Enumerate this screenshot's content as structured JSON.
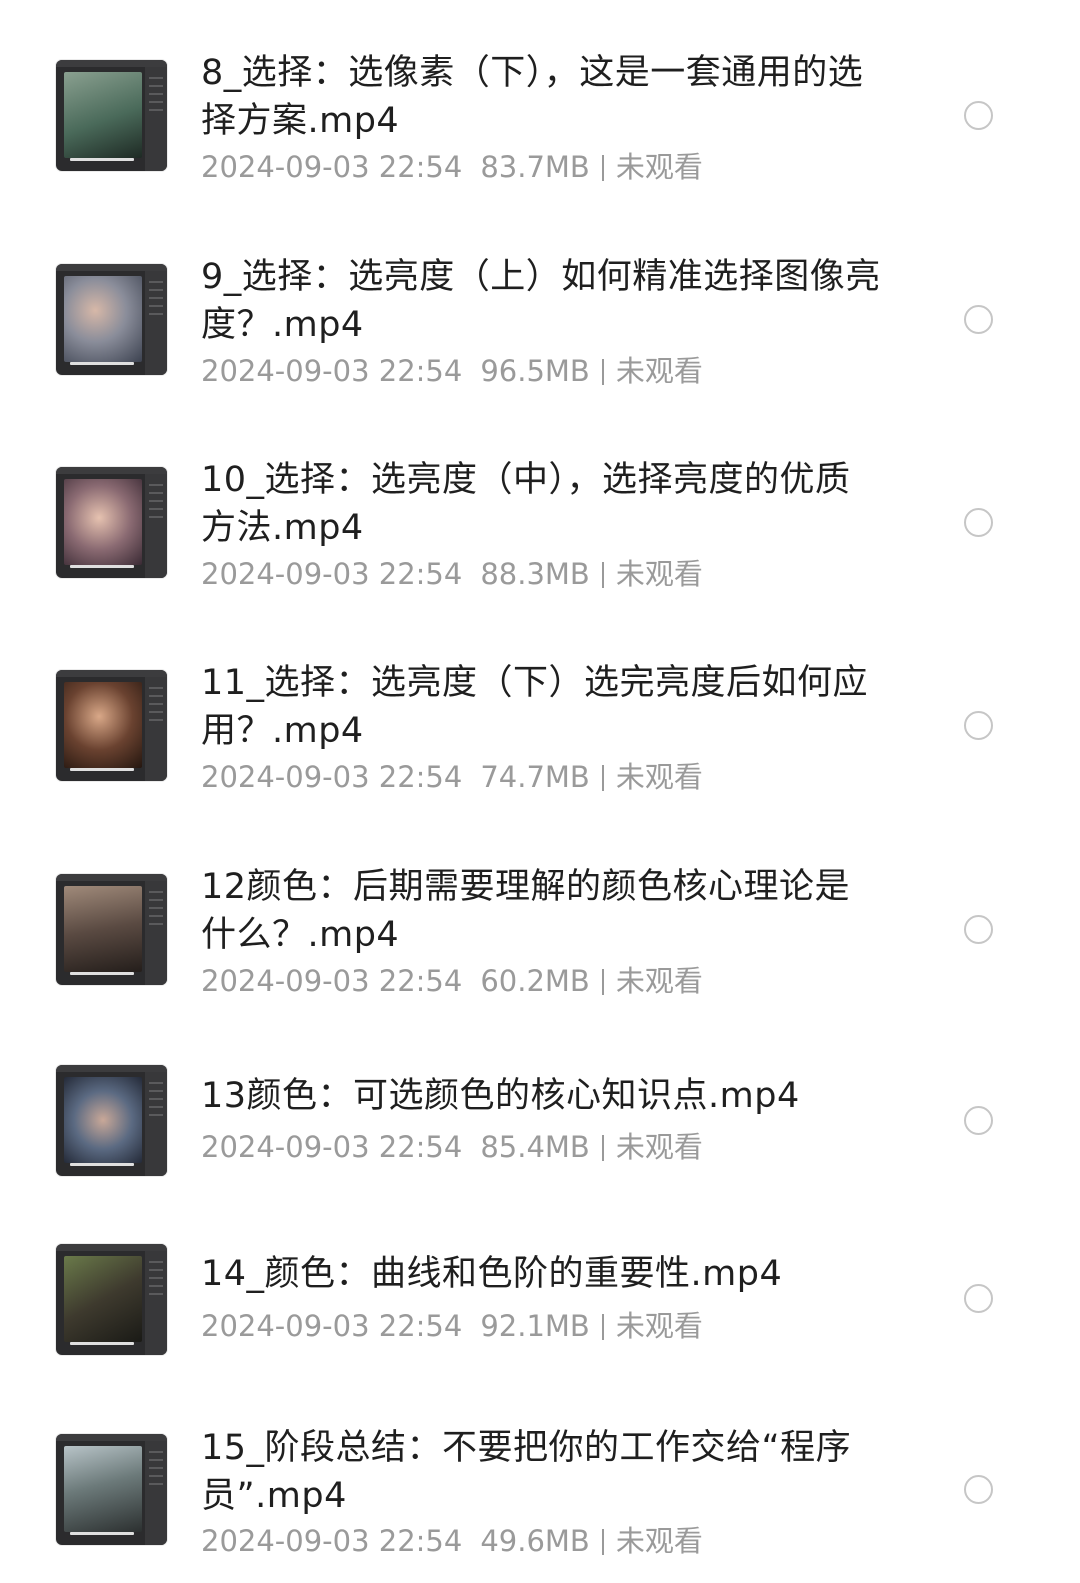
{
  "files": [
    {
      "title": "8_选择：选像素（下），这是一套通用的选择方案.mp4",
      "date": "2024-09-03 22:54",
      "size": "83.7MB",
      "status": "未观看",
      "thumb_icon": "video-thumbnail-icon",
      "thumb_color": "#4a6a5a"
    },
    {
      "title": "9_选择：选亮度（上）如何精准选择图像亮度？.mp4",
      "date": "2024-09-03 22:54",
      "size": "96.5MB",
      "status": "未观看",
      "thumb_icon": "video-thumbnail-icon",
      "thumb_color": "#7a7f8c"
    },
    {
      "title": "10_选择：选亮度（中），选择亮度的优质方法.mp4",
      "date": "2024-09-03 22:54",
      "size": "88.3MB",
      "status": "未观看",
      "thumb_icon": "video-thumbnail-icon",
      "thumb_color": "#6b5a6a"
    },
    {
      "title": "11_选择：选亮度（下）选完亮度后如何应用？.mp4",
      "date": "2024-09-03 22:54",
      "size": "74.7MB",
      "status": "未观看",
      "thumb_icon": "video-thumbnail-icon",
      "thumb_color": "#5a3e30"
    },
    {
      "title": "12颜色：后期需要理解的颜色核心理论是什么？.mp4",
      "date": "2024-09-03 22:54",
      "size": "60.2MB",
      "status": "未观看",
      "thumb_icon": "video-thumbnail-icon",
      "thumb_color": "#4f4640"
    },
    {
      "title": "13颜色：可选颜色的核心知识点.mp4",
      "date": "2024-09-03 22:54",
      "size": "85.4MB",
      "status": "未观看",
      "thumb_icon": "video-thumbnail-icon",
      "thumb_color": "#5b6a82"
    },
    {
      "title": "14_颜色：曲线和色阶的重要性.mp4",
      "date": "2024-09-03 22:54",
      "size": "92.1MB",
      "status": "未观看",
      "thumb_icon": "video-thumbnail-icon",
      "thumb_color": "#4a4a3c"
    },
    {
      "title": "15_阶段总结：不要把你的工作交给“程序员”.mp4",
      "date": "2024-09-03 22:54",
      "size": "49.6MB",
      "status": "未观看",
      "thumb_icon": "video-thumbnail-icon",
      "thumb_color": "#6c7a7a"
    }
  ]
}
